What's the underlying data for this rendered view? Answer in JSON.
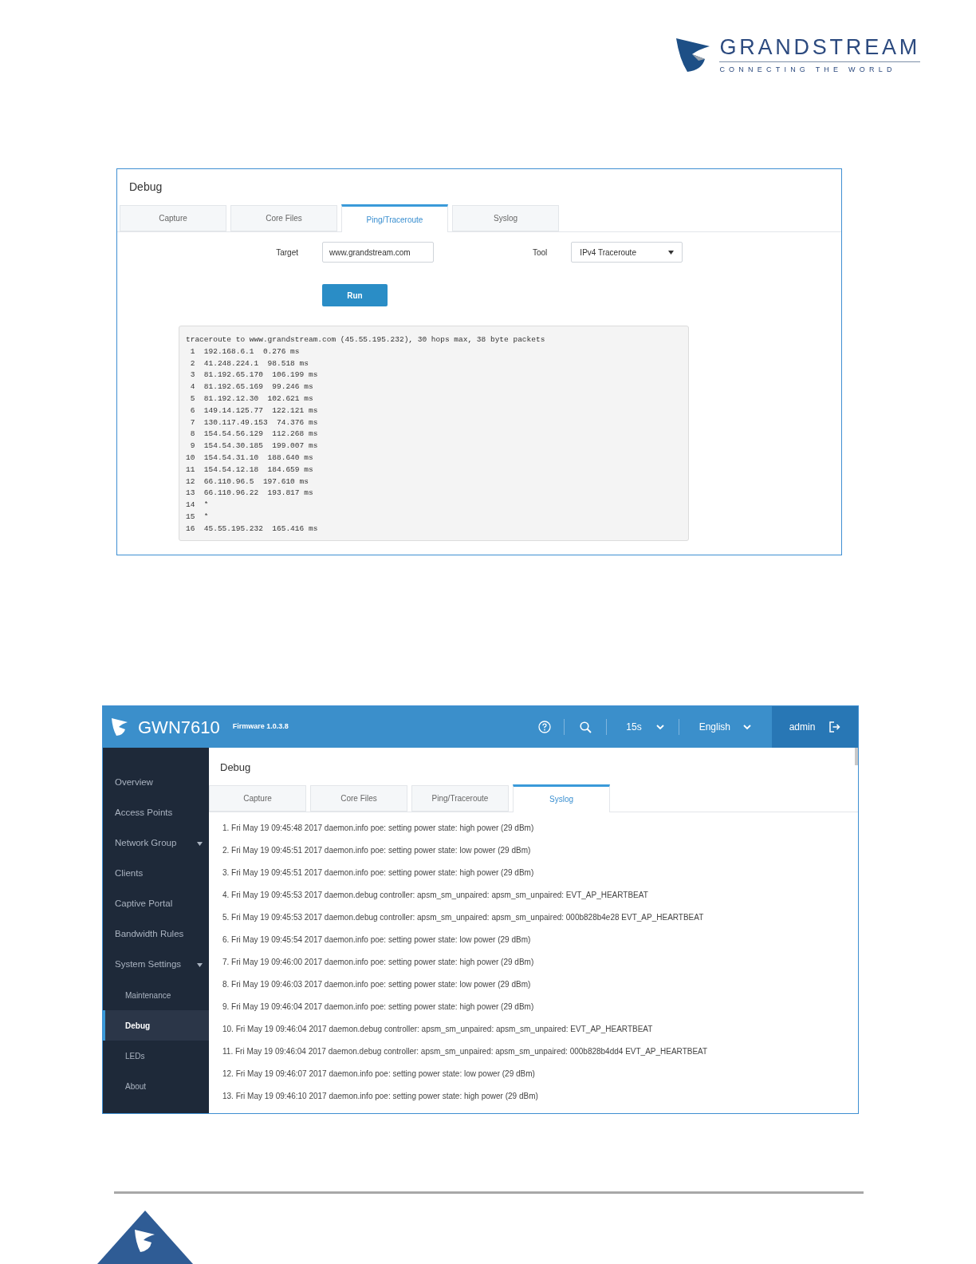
{
  "brand": {
    "name": "GRANDSTREAM",
    "tagline": "CONNECTING THE WORLD"
  },
  "ping_screen": {
    "title": "Debug",
    "tabs": [
      {
        "label": "Capture",
        "selected": false
      },
      {
        "label": "Core Files",
        "selected": false
      },
      {
        "label": "Ping/Traceroute",
        "selected": true
      },
      {
        "label": "Syslog",
        "selected": false
      }
    ],
    "target": {
      "label": "Target",
      "value": "www.grandstream.com"
    },
    "tool": {
      "label": "Tool",
      "value": "IPv4 Traceroute"
    },
    "run_button": "Run",
    "output": [
      "traceroute to www.grandstream.com (45.55.195.232), 30 hops max, 38 byte packets",
      " 1  192.168.6.1  0.276 ms",
      " 2  41.248.224.1  98.518 ms",
      " 3  81.192.65.170  106.199 ms",
      " 4  81.192.65.169  99.246 ms",
      " 5  81.192.12.30  102.621 ms",
      " 6  149.14.125.77  122.121 ms",
      " 7  130.117.49.153  74.376 ms",
      " 8  154.54.56.129  112.268 ms",
      " 9  154.54.30.185  199.007 ms",
      "10  154.54.31.10  188.640 ms",
      "11  154.54.12.18  184.659 ms",
      "12  66.110.96.5  197.610 ms",
      "13  66.110.96.22  193.817 ms",
      "14  *",
      "15  *",
      "16  45.55.195.232  165.416 ms"
    ]
  },
  "syslog_screen": {
    "product": "GWN7610",
    "firmware": "Firmware 1.0.3.8",
    "refresh": "15s",
    "language": "English",
    "user": "admin",
    "sidebar": [
      {
        "label": "Overview",
        "kind": "link",
        "selected": false
      },
      {
        "label": "Access Points",
        "kind": "link",
        "selected": false
      },
      {
        "label": "Network Group",
        "kind": "group",
        "selected": false
      },
      {
        "label": "Clients",
        "kind": "link",
        "selected": false
      },
      {
        "label": "Captive Portal",
        "kind": "link",
        "selected": false
      },
      {
        "label": "Bandwidth Rules",
        "kind": "link",
        "selected": false
      },
      {
        "label": "System Settings",
        "kind": "group",
        "selected": false,
        "children": [
          {
            "label": "Maintenance",
            "selected": false
          },
          {
            "label": "Debug",
            "selected": true
          },
          {
            "label": "LEDs",
            "selected": false
          },
          {
            "label": "About",
            "selected": false
          }
        ]
      }
    ],
    "title": "Debug",
    "tabs": [
      {
        "label": "Capture",
        "selected": false
      },
      {
        "label": "Core Files",
        "selected": false
      },
      {
        "label": "Ping/Traceroute",
        "selected": false
      },
      {
        "label": "Syslog",
        "selected": true
      }
    ],
    "log": [
      "1. Fri May 19 09:45:48 2017 daemon.info poe: setting power state: high power (29 dBm)",
      "2. Fri May 19 09:45:51 2017 daemon.info poe: setting power state: low power (29 dBm)",
      "3. Fri May 19 09:45:51 2017 daemon.info poe: setting power state: high power (29 dBm)",
      "4. Fri May 19 09:45:53 2017 daemon.debug controller: apsm_sm_unpaired: apsm_sm_unpaired: EVT_AP_HEARTBEAT",
      "5. Fri May 19 09:45:53 2017 daemon.debug controller: apsm_sm_unpaired: apsm_sm_unpaired: 000b828b4e28 EVT_AP_HEARTBEAT",
      "6. Fri May 19 09:45:54 2017 daemon.info poe: setting power state: low power (29 dBm)",
      "7. Fri May 19 09:46:00 2017 daemon.info poe: setting power state: high power (29 dBm)",
      "8. Fri May 19 09:46:03 2017 daemon.info poe: setting power state: low power (29 dBm)",
      "9. Fri May 19 09:46:04 2017 daemon.info poe: setting power state: high power (29 dBm)",
      "10. Fri May 19 09:46:04 2017 daemon.debug controller: apsm_sm_unpaired: apsm_sm_unpaired: EVT_AP_HEARTBEAT",
      "11. Fri May 19 09:46:04 2017 daemon.debug controller: apsm_sm_unpaired: apsm_sm_unpaired: 000b828b4dd4 EVT_AP_HEARTBEAT",
      "12. Fri May 19 09:46:07 2017 daemon.info poe: setting power state: low power (29 dBm)",
      "13. Fri May 19 09:46:10 2017 daemon.info poe: setting power state: high power (29 dBm)"
    ]
  }
}
